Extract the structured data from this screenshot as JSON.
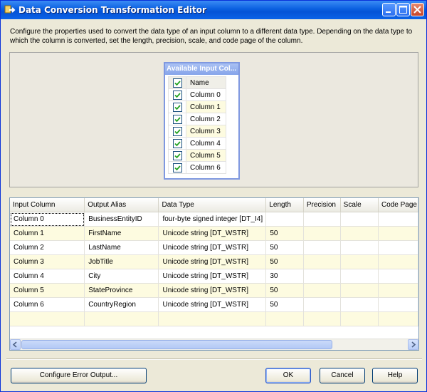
{
  "window": {
    "title": "Data Conversion Transformation Editor",
    "icons": {
      "app": "transform-icon",
      "minimize": "minimize-icon",
      "maximize": "maximize-icon",
      "close": "close-icon"
    }
  },
  "description": "Configure the properties used to convert the data type of an input column to a different data type. Depending on the data type to which the column is converted, set the length, precision, scale, and code page of the column.",
  "available_inputs": {
    "title": "Available Input Col...",
    "header": "Name",
    "header_checked": true,
    "columns": [
      {
        "name": "Column 0",
        "checked": true
      },
      {
        "name": "Column 1",
        "checked": true
      },
      {
        "name": "Column 2",
        "checked": true
      },
      {
        "name": "Column 3",
        "checked": true
      },
      {
        "name": "Column 4",
        "checked": true
      },
      {
        "name": "Column 5",
        "checked": true
      },
      {
        "name": "Column 6",
        "checked": true
      }
    ]
  },
  "grid": {
    "headers": [
      "Input Column",
      "Output Alias",
      "Data Type",
      "Length",
      "Precision",
      "Scale",
      "Code Page"
    ],
    "rows": [
      [
        "Column 0",
        "BusinessEntityID",
        "four-byte signed integer [DT_I4]",
        "",
        "",
        "",
        ""
      ],
      [
        "Column 1",
        "FirstName",
        "Unicode string [DT_WSTR]",
        "50",
        "",
        "",
        ""
      ],
      [
        "Column 2",
        "LastName",
        "Unicode string [DT_WSTR]",
        "50",
        "",
        "",
        ""
      ],
      [
        "Column 3",
        "JobTitle",
        "Unicode string [DT_WSTR]",
        "50",
        "",
        "",
        ""
      ],
      [
        "Column 4",
        "City",
        "Unicode string [DT_WSTR]",
        "30",
        "",
        "",
        ""
      ],
      [
        "Column 5",
        "StateProvince",
        "Unicode string [DT_WSTR]",
        "50",
        "",
        "",
        ""
      ],
      [
        "Column 6",
        "CountryRegion",
        "Unicode string [DT_WSTR]",
        "50",
        "",
        "",
        ""
      ]
    ]
  },
  "buttons": {
    "configure_error": "Configure Error Output...",
    "ok": "OK",
    "cancel": "Cancel",
    "help": "Help"
  },
  "colors": {
    "title_bar": "#0a5fe0",
    "dialog_bg": "#ece9d8",
    "alt_row": "#fdfbe0"
  }
}
